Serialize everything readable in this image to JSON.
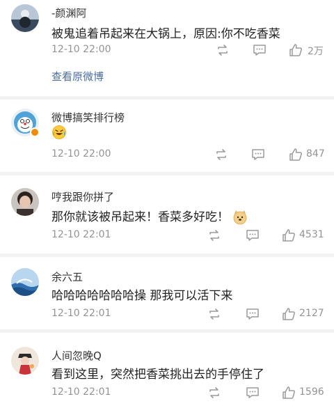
{
  "comments": [
    {
      "user": "-颜渊阿",
      "text": "被鬼追着吊起来在大锅上，原因:你不吃香菜",
      "time": "12-10 22:00",
      "likes": "2万",
      "view_original": "查看原微博"
    },
    {
      "user": "微博搞笑排行榜",
      "text": "",
      "emoji": "laughing-crying-emoji",
      "time": "12-10 22:00",
      "likes": "847"
    },
    {
      "user": "哼我跟你拼了",
      "text": "那你就该被吊起来！香菜多好吃！",
      "emoji": "doge-emoji",
      "time": "12-10 22:01",
      "likes": "4531"
    },
    {
      "user": "余六五",
      "text": "哈哈哈哈哈哈哈操 那我可以活下来",
      "time": "12-10 22:01",
      "likes": "2127"
    },
    {
      "user": "人间忽晚Q",
      "text": "看到这里，突然把香菜挑出去的手停住了",
      "time": "12-10 22:01",
      "likes": "1596"
    }
  ],
  "colors": {
    "link": "#4a6ea3",
    "meta": "#939393",
    "badge": "#f08c00"
  }
}
